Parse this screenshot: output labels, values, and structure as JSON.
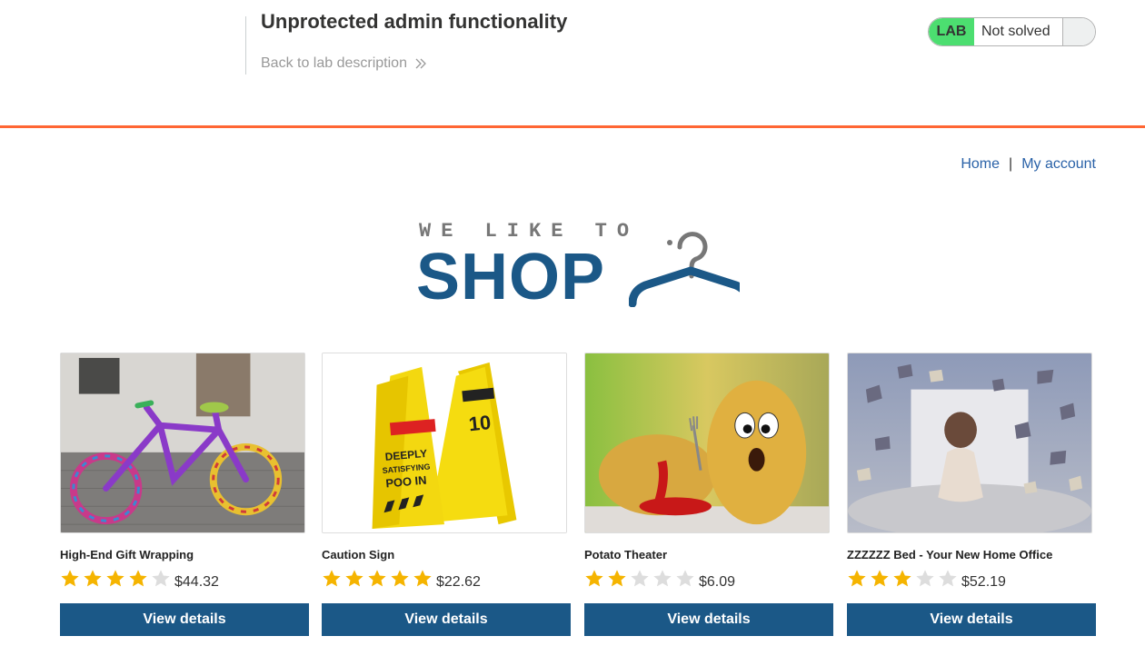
{
  "lab": {
    "title": "Unprotected admin functionality",
    "back_link": "Back to lab description",
    "status_label": "LAB",
    "status_text": "Not solved",
    "accent_color": "#ff6633",
    "status_color": "#4cde70"
  },
  "nav": {
    "home": "Home",
    "separator": "|",
    "my_account": "My account"
  },
  "logo": {
    "top_text": "WE LIKE TO",
    "main_text": "SHOP",
    "icon": "hanger-icon"
  },
  "products": [
    {
      "name": "High-End Gift Wrapping",
      "rating": 4,
      "max_rating": 5,
      "price": "$44.32",
      "button": "View details",
      "image": "knitted-bicycle-image"
    },
    {
      "name": "Caution Sign",
      "rating": 5,
      "max_rating": 5,
      "price": "$22.62",
      "button": "View details",
      "image": "caution-sign-image"
    },
    {
      "name": "Potato Theater",
      "rating": 2,
      "max_rating": 5,
      "price": "$6.09",
      "button": "View details",
      "image": "potatoes-image"
    },
    {
      "name": "ZZZZZZ Bed - Your New Home Office",
      "rating": 3,
      "max_rating": 5,
      "price": "$52.19",
      "button": "View details",
      "image": "flying-books-image"
    }
  ],
  "colors": {
    "brand_blue": "#1b5887",
    "link_blue": "#2a62a8",
    "star_gold": "#f5b400",
    "star_empty": "#dddddd"
  }
}
